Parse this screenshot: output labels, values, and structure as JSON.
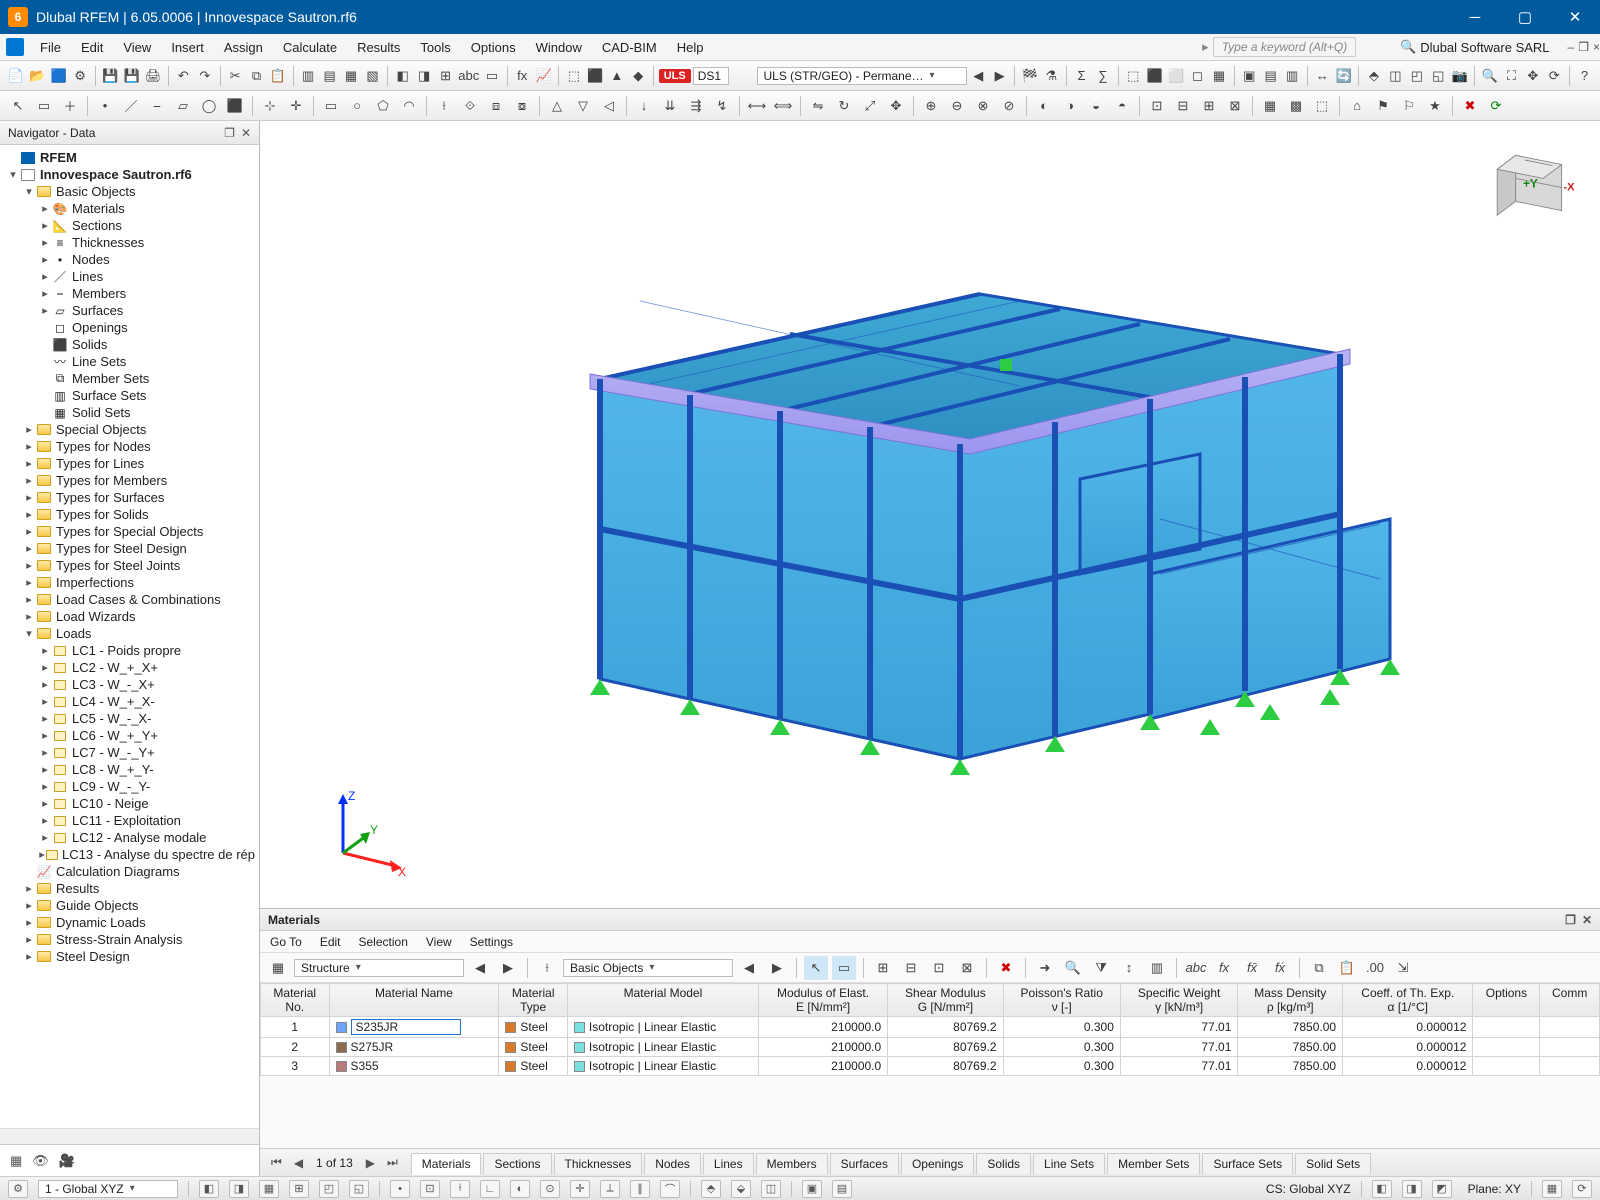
{
  "window": {
    "title": "Dlubal RFEM | 6.05.0006 | Innovespace Sautron.rf6",
    "company": "Dlubal Software SARL"
  },
  "menus": [
    "File",
    "Edit",
    "View",
    "Insert",
    "Assign",
    "Calculate",
    "Results",
    "Tools",
    "Options",
    "Window",
    "CAD-BIM",
    "Help"
  ],
  "keyword_hint": "Type a keyword (Alt+Q)",
  "load_case_badge": "ULS",
  "ds_field": "DS1",
  "load_combo": "ULS (STR/GEO) - Permane…",
  "navigator": {
    "title": "Navigator - Data",
    "root": "RFEM",
    "model": "Innovespace Sautron.rf6",
    "basic_label": "Basic Objects",
    "basic_children": [
      "Materials",
      "Sections",
      "Thicknesses",
      "Nodes",
      "Lines",
      "Members",
      "Surfaces",
      "Openings",
      "Solids",
      "Line Sets",
      "Member Sets",
      "Surface Sets",
      "Solid Sets"
    ],
    "groups": [
      "Special Objects",
      "Types for Nodes",
      "Types for Lines",
      "Types for Members",
      "Types for Surfaces",
      "Types for Solids",
      "Types for Special Objects",
      "Types for Steel Design",
      "Types for Steel Joints",
      "Imperfections",
      "Load Cases & Combinations",
      "Load Wizards"
    ],
    "loads_label": "Loads",
    "loads": [
      "LC1 - Poids propre",
      "LC2 - W_+_X+",
      "LC3 - W_-_X+",
      "LC4 - W_+_X-",
      "LC5 - W_-_X-",
      "LC6 - W_+_Y+",
      "LC7 - W_-_Y+",
      "LC8 - W_+_Y-",
      "LC9 - W_-_Y-",
      "LC10 - Neige",
      "LC11 - Exploitation",
      "LC12 - Analyse modale",
      "LC13 - Analyse du spectre de rép"
    ],
    "tail": [
      "Calculation Diagrams",
      "Results",
      "Guide Objects",
      "Dynamic Loads",
      "Stress-Strain Analysis",
      "Steel Design"
    ]
  },
  "materials_panel": {
    "title": "Materials",
    "menus": [
      "Go To",
      "Edit",
      "Selection",
      "View",
      "Settings"
    ],
    "dropdown1": "Structure",
    "dropdown2": "Basic Objects",
    "columns": [
      "Material\nNo.",
      "Material Name",
      "Material\nType",
      "Material Model",
      "Modulus of Elast.\nE [N/mm²]",
      "Shear Modulus\nG [N/mm²]",
      "Poisson's Ratio\nν [-]",
      "Specific Weight\nγ [kN/m³]",
      "Mass Density\nρ [kg/m³]",
      "Coeff. of Th. Exp.\nα [1/°C]",
      "Options",
      "Comm"
    ],
    "rows": [
      {
        "no": "1",
        "name": "S235JR",
        "swatch": "#6ea4ff",
        "type": "Steel",
        "type_sw": "#d77a2a",
        "model": "Isotropic | Linear Elastic",
        "model_sw": "#7de0e0",
        "E": "210000.0",
        "G": "80769.2",
        "nu": "0.300",
        "gamma": "77.01",
        "rho": "7850.00",
        "alpha": "0.000012"
      },
      {
        "no": "2",
        "name": "S275JR",
        "swatch": "#8a6b52",
        "type": "Steel",
        "type_sw": "#d77a2a",
        "model": "Isotropic | Linear Elastic",
        "model_sw": "#7de0e0",
        "E": "210000.0",
        "G": "80769.2",
        "nu": "0.300",
        "gamma": "77.01",
        "rho": "7850.00",
        "alpha": "0.000012"
      },
      {
        "no": "3",
        "name": "S355",
        "swatch": "#b97a7a",
        "type": "Steel",
        "type_sw": "#d77a2a",
        "model": "Isotropic | Linear Elastic",
        "model_sw": "#7de0e0",
        "E": "210000.0",
        "G": "80769.2",
        "nu": "0.300",
        "gamma": "77.01",
        "rho": "7850.00",
        "alpha": "0.000012"
      }
    ]
  },
  "bottom_tabs": {
    "page": "1 of 13",
    "tabs": [
      "Materials",
      "Sections",
      "Thicknesses",
      "Nodes",
      "Lines",
      "Members",
      "Surfaces",
      "Openings",
      "Solids",
      "Line Sets",
      "Member Sets",
      "Surface Sets",
      "Solid Sets"
    ]
  },
  "statusbar": {
    "cs_selector": "1 - Global XYZ",
    "cs": "CS: Global XYZ",
    "plane": "Plane: XY"
  },
  "axes": {
    "x": "X",
    "y": "Y",
    "z": "Z"
  },
  "cube": {
    "y": "+Y",
    "x": "-X"
  }
}
